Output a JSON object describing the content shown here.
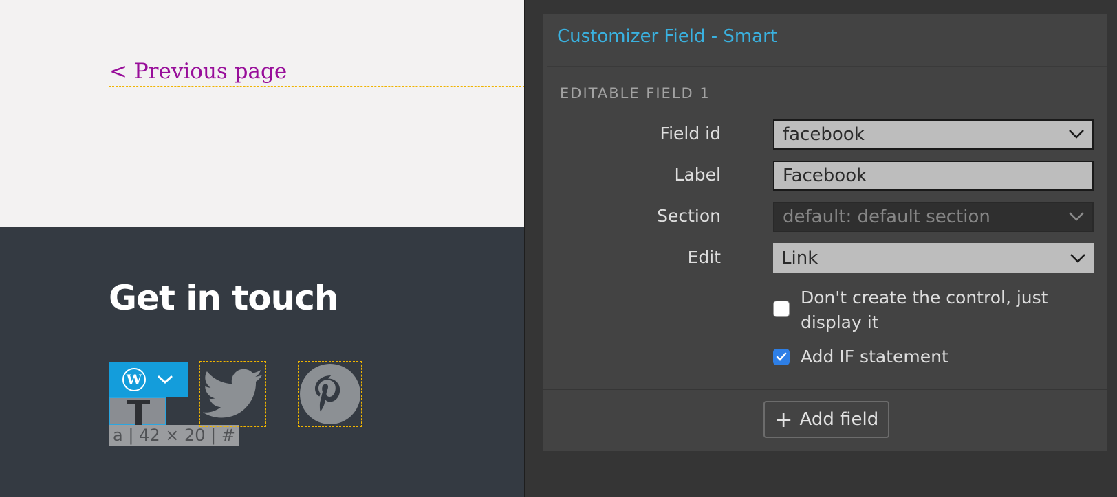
{
  "canvas": {
    "prev_page_link": "< Previous page",
    "footer_title": "Get in touch",
    "selection_label": "a | 42 × 20 | #",
    "social_icons": [
      "twitter-icon",
      "pinterest-icon"
    ],
    "colors": {
      "link": "#980e9a",
      "footer_bg": "#343a42",
      "toolbar": "#149ddb",
      "highlight": "#f0b400"
    }
  },
  "panel": {
    "title": "Customizer Field - Smart",
    "section_heading": "EDITABLE FIELD 1",
    "fields": {
      "field_id": {
        "label": "Field id",
        "value": "facebook"
      },
      "label": {
        "label": "Label",
        "value": "Facebook"
      },
      "section": {
        "label": "Section",
        "value": "default: default section"
      },
      "edit": {
        "label": "Edit",
        "value": "Link"
      }
    },
    "checkboxes": [
      {
        "label": "Don't create the control, just display it",
        "checked": false
      },
      {
        "label": "Add IF statement",
        "checked": true
      }
    ],
    "add_button": {
      "icon": "+",
      "label": "Add field"
    },
    "colors": {
      "title": "#3ab1df",
      "checkbox_checked": "#2e7fe6"
    }
  }
}
